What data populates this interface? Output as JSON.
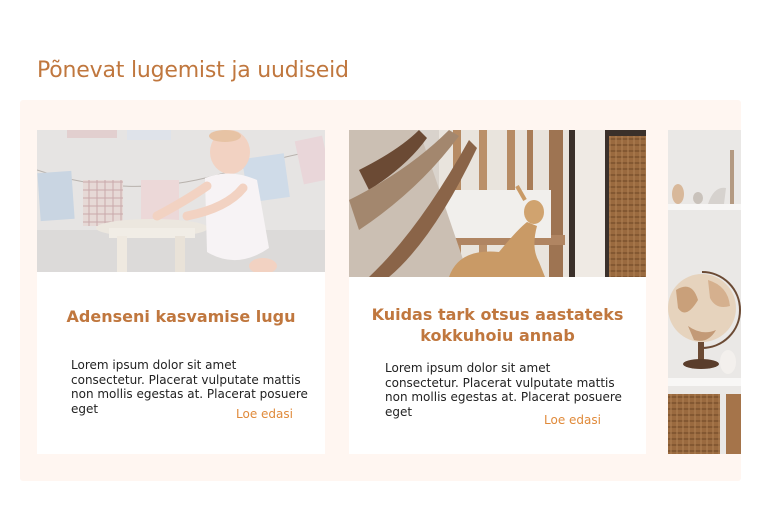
{
  "section": {
    "title": "Põnevat lugemist ja uudiseid"
  },
  "cards": [
    {
      "title": "Adenseni kasvamise lugu",
      "excerpt": "Lorem ipsum dolor sit amet consectetur. Placerat vulputate mattis non mollis egestas at. Placerat posuere eget",
      "link": "Loe edasi",
      "image": "baby-standing-at-stool-photo"
    },
    {
      "title": "Kuidas tark otsus aastateks kokkuhoiu annab",
      "excerpt": "Lorem ipsum dolor sit amet consectetur. Placerat vulputate mattis non mollis egestas at. Placerat posuere eget",
      "link": "Loe edasi",
      "image": "wooden-crib-and-toy-deer-photo"
    },
    {
      "image": "nursery-shelf-with-globe-photo"
    }
  ],
  "colors": {
    "accent": "#c0773e",
    "link": "#e08a3a",
    "section_background": "#fff6f1",
    "text": "#222222"
  }
}
